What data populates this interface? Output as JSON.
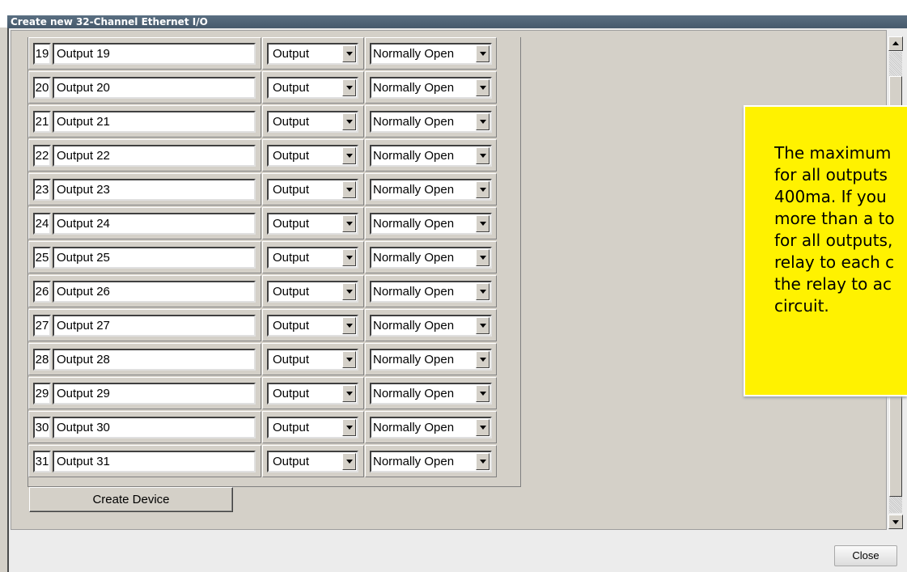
{
  "window": {
    "title": "Create new 32-Channel Ethernet I/O"
  },
  "rows": [
    {
      "num": "19",
      "name": "Output 19",
      "type": "Output",
      "mode": "Normally Open"
    },
    {
      "num": "20",
      "name": "Output 20",
      "type": "Output",
      "mode": "Normally Open"
    },
    {
      "num": "21",
      "name": "Output 21",
      "type": "Output",
      "mode": "Normally Open"
    },
    {
      "num": "22",
      "name": "Output 22",
      "type": "Output",
      "mode": "Normally Open"
    },
    {
      "num": "23",
      "name": "Output 23",
      "type": "Output",
      "mode": "Normally Open"
    },
    {
      "num": "24",
      "name": "Output 24",
      "type": "Output",
      "mode": "Normally Open"
    },
    {
      "num": "25",
      "name": "Output 25",
      "type": "Output",
      "mode": "Normally Open"
    },
    {
      "num": "26",
      "name": "Output 26",
      "type": "Output",
      "mode": "Normally Open"
    },
    {
      "num": "27",
      "name": "Output 27",
      "type": "Output",
      "mode": "Normally Open"
    },
    {
      "num": "28",
      "name": "Output 28",
      "type": "Output",
      "mode": "Normally Open"
    },
    {
      "num": "29",
      "name": "Output 29",
      "type": "Output",
      "mode": "Normally Open"
    },
    {
      "num": "30",
      "name": "Output 30",
      "type": "Output",
      "mode": "Normally Open"
    },
    {
      "num": "31",
      "name": "Output 31",
      "type": "Output",
      "mode": "Normally Open"
    }
  ],
  "buttons": {
    "create": "Create Device",
    "close": "Close"
  },
  "tooltip": {
    "text": "The maximum\nfor all outputs\n400ma. If you\nmore than a to\nfor all outputs,\nrelay to each c\nthe relay to ac\ncircuit.",
    "background": "#fff200"
  },
  "colors": {
    "titlebar": "#4f6375",
    "panel": "#d4d0c8"
  }
}
